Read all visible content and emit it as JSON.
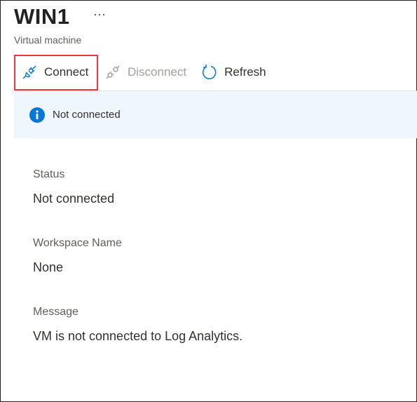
{
  "header": {
    "title": "WIN1",
    "more_label": "···",
    "subtitle": "Virtual machine"
  },
  "toolbar": {
    "connect": "Connect",
    "disconnect": "Disconnect",
    "refresh": "Refresh"
  },
  "banner": {
    "icon": "info-icon",
    "text": "Not connected"
  },
  "fields": [
    {
      "label": "Status",
      "value": "Not connected"
    },
    {
      "label": "Workspace Name",
      "value": "None"
    },
    {
      "label": "Message",
      "value": "VM is not connected to Log Analytics."
    }
  ],
  "colors": {
    "accent": "#0078d4",
    "highlight": "#e8383d",
    "banner_bg": "#eff6fc"
  }
}
